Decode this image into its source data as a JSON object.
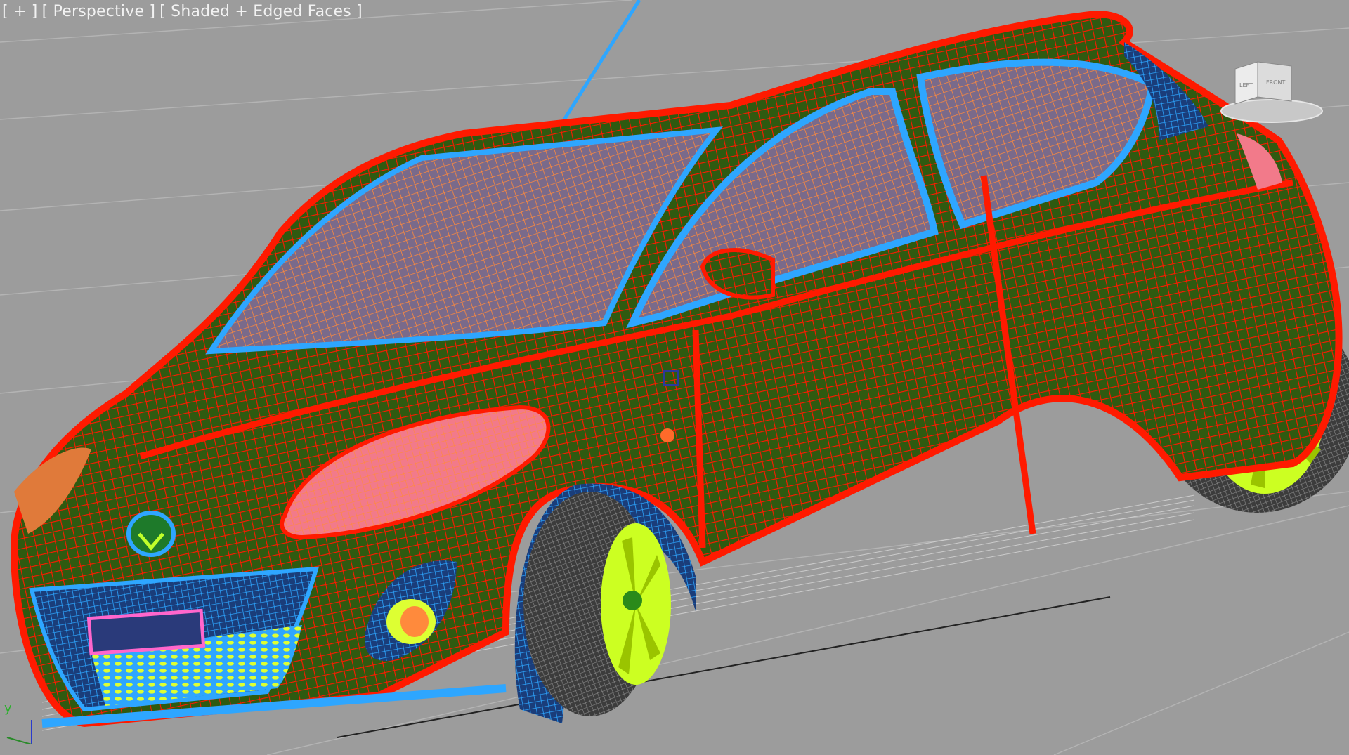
{
  "viewport": {
    "menu_label": "[ + ]",
    "view_label": "[ Perspective ]",
    "shading_label": "[ Shaded + Edged Faces ]"
  },
  "viewcube": {
    "left_face": "LEFT",
    "front_face": "FRONT"
  },
  "axis": {
    "y_label": "y"
  },
  "colors": {
    "background": "#9c9c9c",
    "grid": "#b4b4b4",
    "body_wire": "#ff1a00",
    "body_fill": "#2f5a10",
    "glass_wire": "#ff8a3c",
    "trim": "#2ea6ff",
    "wheel": "#ccff22",
    "tire": "#555555",
    "headlight": "#f27a8a",
    "antenna": "#2ea6ff"
  },
  "icons": [
    "viewcube-icon",
    "axis-tripod-icon",
    "car-mesh-icon"
  ]
}
